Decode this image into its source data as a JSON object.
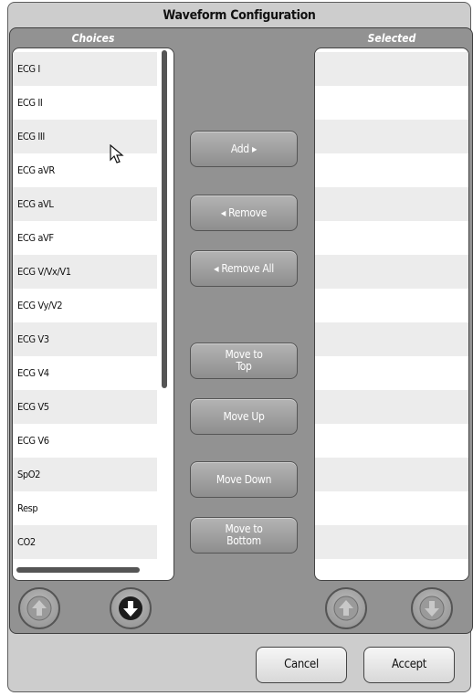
{
  "dialog": {
    "title": "Waveform Configuration"
  },
  "choices": {
    "header": "Choices",
    "items": [
      "ECG I",
      "ECG II",
      "ECG III",
      "ECG aVR",
      "ECG aVL",
      "ECG aVF",
      "ECG V/Vx/V1",
      "ECG Vy/V2",
      "ECG V3",
      "ECG V4",
      "ECG V5",
      "ECG V6",
      "SpO2",
      "Resp",
      "CO2"
    ]
  },
  "selected": {
    "header": "Selected",
    "items": []
  },
  "actions": {
    "add": "Add ▸",
    "remove": "◂ Remove",
    "remove_all": "◂ Remove All",
    "move_top": "Move to\nTop",
    "move_up": "Move Up",
    "move_down": "Move Down",
    "move_bottom": "Move to\nBottom"
  },
  "footer": {
    "cancel": "Cancel",
    "accept": "Accept"
  },
  "icons": {
    "scroll_up": "arrow-up-circle-icon",
    "scroll_down": "arrow-down-circle-icon",
    "cursor": "mouse-pointer-icon"
  }
}
